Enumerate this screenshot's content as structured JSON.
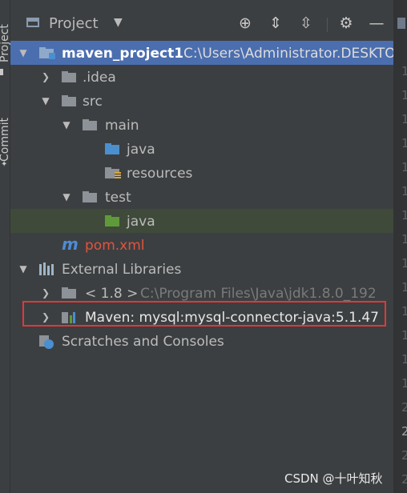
{
  "sidebar": {
    "project_tab": "Project",
    "commit_tab": "Commit"
  },
  "header": {
    "title": "Project",
    "buttons": [
      "locate-icon",
      "expand-all-icon",
      "collapse-all-icon",
      "gear-icon",
      "hide-icon"
    ]
  },
  "tree": {
    "root_name": "maven_project1",
    "root_path": "C:\\Users\\Administrator.DESKTO",
    "idea": ".idea",
    "src": "src",
    "main": "main",
    "main_java": "java",
    "resources": "resources",
    "test": "test",
    "test_java": "java",
    "pom": "pom.xml",
    "pom_icon_letter": "m",
    "external_libraries": "External Libraries",
    "jdk_label": "< 1.8 >",
    "jdk_path": "C:\\Program Files\\Java\\jdk1.8.0_192",
    "maven_lib": "Maven: mysql:mysql-connector-java:5.1.47",
    "scratches": "Scratches and Consoles"
  },
  "gutter": {
    "line_numbers": [
      "1",
      "1",
      "1",
      "1",
      "1",
      "1",
      "1",
      "1",
      "1",
      "1",
      "1",
      "1",
      "1",
      "1",
      "2",
      "2",
      "2",
      "2",
      "2"
    ]
  },
  "watermark": "CSDN @十叶知秋",
  "colors": {
    "selection": "#4b6eaf",
    "highlight_row": "#3f4a3a",
    "red_box": "#e0383a",
    "pom_text": "#e0543f",
    "source_folder": "#4a8fcf",
    "test_folder": "#5f9a3a"
  }
}
